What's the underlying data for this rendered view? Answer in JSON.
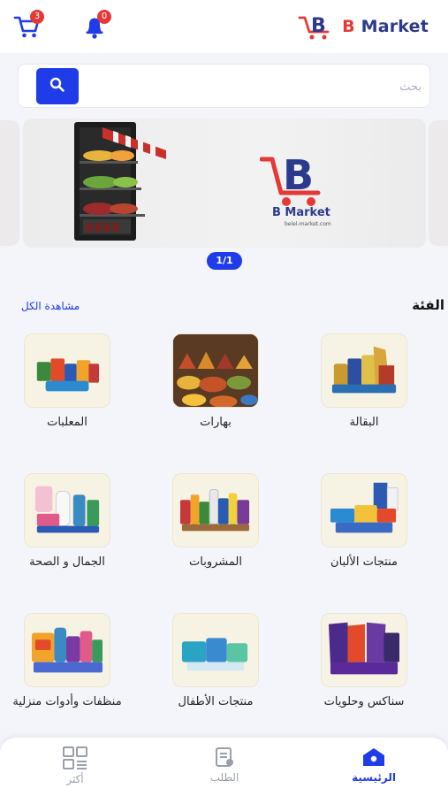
{
  "header": {
    "cart_count": "3",
    "notifications_count": "0",
    "logo_text": "Market",
    "logo_letter": "B"
  },
  "search": {
    "placeholder": "بحث"
  },
  "banner": {
    "brand": "B Market",
    "url": "belel-market.com",
    "pager": "1/1"
  },
  "categories": {
    "title": "الفئة",
    "view_all": "مشاهدة الكل",
    "items": [
      {
        "label": "البقالة",
        "icon": "grocery-icon"
      },
      {
        "label": "بهارات",
        "icon": "spices-icon"
      },
      {
        "label": "المعلبات",
        "icon": "canned-food-icon"
      },
      {
        "label": "منتجات الألبان",
        "icon": "dairy-icon"
      },
      {
        "label": "المشروبات",
        "icon": "drinks-icon"
      },
      {
        "label": "الجمال و الصحة",
        "icon": "beauty-health-icon"
      },
      {
        "label": "سناكس وحلويات",
        "icon": "snacks-icon"
      },
      {
        "label": "منتجات الأطفال",
        "icon": "baby-products-icon"
      },
      {
        "label": "منظفات وأدوات منزلية",
        "icon": "cleaning-icon"
      }
    ]
  },
  "bottom_nav": {
    "home": "الرئيسية",
    "orders": "الطلب",
    "more": "أكثر"
  },
  "colors": {
    "primary": "#1f3ce8",
    "badge": "#e53935",
    "brand_navy": "#2b3a8c",
    "background": "#f3f5fb"
  }
}
